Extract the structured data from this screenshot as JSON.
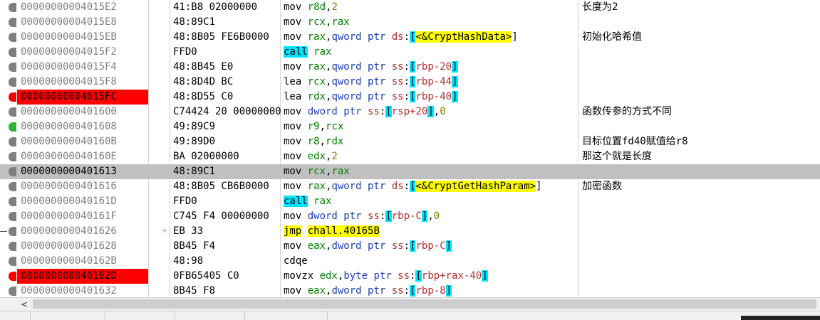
{
  "rows": [
    {
      "address": "00000000004015E2",
      "bytes": "41:B8 02000000",
      "comment": "长度为2"
    },
    {
      "address": "00000000004015E8",
      "bytes": "48:89C1",
      "comment": ""
    },
    {
      "address": "00000000004015EB",
      "bytes": "48:8B05 FE6B0000",
      "comment": "初始化哈希值"
    },
    {
      "address": "00000000004015F2",
      "bytes": "FFD0",
      "comment": ""
    },
    {
      "address": "00000000004015F4",
      "bytes": "48:8B45 E0",
      "comment": ""
    },
    {
      "address": "00000000004015F8",
      "bytes": "48:8D4D BC",
      "comment": ""
    },
    {
      "address": "00000000004015FC",
      "bytes": "48:8D55 C0",
      "comment": ""
    },
    {
      "address": "0000000000401600",
      "bytes": "C74424 20 00000000",
      "comment": "函数传参的方式不同"
    },
    {
      "address": "0000000000401608",
      "bytes": "49:89C9",
      "comment": ""
    },
    {
      "address": "000000000040160B",
      "bytes": "49:89D0",
      "comment": "目标位置fd40赋值给r8"
    },
    {
      "address": "000000000040160E",
      "bytes": "BA 02000000",
      "comment": "那这个就是长度"
    },
    {
      "address": "0000000000401613",
      "bytes": "48:89C1",
      "comment": ""
    },
    {
      "address": "0000000000401616",
      "bytes": "48:8B05 CB6B0000",
      "comment": "加密函数"
    },
    {
      "address": "000000000040161D",
      "bytes": "FFD0",
      "comment": ""
    },
    {
      "address": "000000000040161F",
      "bytes": "C745 F4 00000000",
      "comment": ""
    },
    {
      "address": "0000000000401626",
      "bytes": "EB 33",
      "comment": ""
    },
    {
      "address": "0000000000401628",
      "bytes": "8B45 F4",
      "comment": ""
    },
    {
      "address": "000000000040162B",
      "bytes": "48:98",
      "comment": ""
    },
    {
      "address": "000000000040162D",
      "bytes": "0FB65405 C0",
      "comment": ""
    },
    {
      "address": "0000000000401632",
      "bytes": "8B45 F8",
      "comment": ""
    }
  ],
  "asm": [
    [
      {
        "t": "mov ",
        "c": ""
      },
      {
        "t": "r8d",
        "c": "reg"
      },
      {
        "t": ",",
        "c": ""
      },
      {
        "t": "2",
        "c": "num"
      }
    ],
    [
      {
        "t": "mov ",
        "c": ""
      },
      {
        "t": "rcx",
        "c": "reg"
      },
      {
        "t": ",",
        "c": ""
      },
      {
        "t": "rax",
        "c": "reg"
      }
    ],
    [
      {
        "t": "mov ",
        "c": ""
      },
      {
        "t": "rax",
        "c": "reg"
      },
      {
        "t": ",",
        "c": ""
      },
      {
        "t": "qword ptr ",
        "c": "ptrkw"
      },
      {
        "t": "ds",
        "c": "seg"
      },
      {
        "t": ":",
        "c": ""
      },
      {
        "t": "[",
        "c": "br"
      },
      {
        "t": "<&CryptHashData>",
        "c": "sym"
      },
      {
        "t": "]",
        "c": ""
      }
    ],
    [
      {
        "t": "call",
        "c": "kw-call"
      },
      {
        "t": " ",
        "c": ""
      },
      {
        "t": "rax",
        "c": "reg"
      }
    ],
    [
      {
        "t": "mov ",
        "c": ""
      },
      {
        "t": "rax",
        "c": "reg"
      },
      {
        "t": ",",
        "c": ""
      },
      {
        "t": "qword ptr ",
        "c": "ptrkw"
      },
      {
        "t": "ss",
        "c": "seg"
      },
      {
        "t": ":",
        "c": ""
      },
      {
        "t": "[",
        "c": "br"
      },
      {
        "t": "rbp-20",
        "c": "off"
      },
      {
        "t": "]",
        "c": "br"
      }
    ],
    [
      {
        "t": "lea ",
        "c": ""
      },
      {
        "t": "rcx",
        "c": "reg"
      },
      {
        "t": ",",
        "c": ""
      },
      {
        "t": "qword ptr ",
        "c": "ptrkw"
      },
      {
        "t": "ss",
        "c": "seg"
      },
      {
        "t": ":",
        "c": ""
      },
      {
        "t": "[",
        "c": "br"
      },
      {
        "t": "rbp-44",
        "c": "off"
      },
      {
        "t": "]",
        "c": "br"
      }
    ],
    [
      {
        "t": "lea ",
        "c": ""
      },
      {
        "t": "rdx",
        "c": "reg"
      },
      {
        "t": ",",
        "c": ""
      },
      {
        "t": "qword ptr ",
        "c": "ptrkw"
      },
      {
        "t": "ss",
        "c": "seg"
      },
      {
        "t": ":",
        "c": ""
      },
      {
        "t": "[",
        "c": "br"
      },
      {
        "t": "rbp-40",
        "c": "off"
      },
      {
        "t": "]",
        "c": "br"
      }
    ],
    [
      {
        "t": "mov ",
        "c": ""
      },
      {
        "t": "dword ptr ",
        "c": "ptrkw"
      },
      {
        "t": "ss",
        "c": "seg"
      },
      {
        "t": ":",
        "c": ""
      },
      {
        "t": "[",
        "c": "br"
      },
      {
        "t": "rsp+20",
        "c": "off"
      },
      {
        "t": "]",
        "c": "br"
      },
      {
        "t": ",",
        "c": ""
      },
      {
        "t": "0",
        "c": "num"
      }
    ],
    [
      {
        "t": "mov ",
        "c": ""
      },
      {
        "t": "r9",
        "c": "reg"
      },
      {
        "t": ",",
        "c": ""
      },
      {
        "t": "rcx",
        "c": "reg"
      }
    ],
    [
      {
        "t": "mov ",
        "c": ""
      },
      {
        "t": "r8",
        "c": "reg"
      },
      {
        "t": ",",
        "c": ""
      },
      {
        "t": "rdx",
        "c": "reg"
      }
    ],
    [
      {
        "t": "mov ",
        "c": ""
      },
      {
        "t": "edx",
        "c": "reg"
      },
      {
        "t": ",",
        "c": ""
      },
      {
        "t": "2",
        "c": "num"
      }
    ],
    [
      {
        "t": "mov ",
        "c": ""
      },
      {
        "t": "rcx",
        "c": "reg"
      },
      {
        "t": ",",
        "c": ""
      },
      {
        "t": "rax",
        "c": "reg"
      }
    ],
    [
      {
        "t": "mov ",
        "c": ""
      },
      {
        "t": "rax",
        "c": "reg"
      },
      {
        "t": ",",
        "c": ""
      },
      {
        "t": "qword ptr ",
        "c": "ptrkw"
      },
      {
        "t": "ds",
        "c": "seg"
      },
      {
        "t": ":",
        "c": ""
      },
      {
        "t": "[",
        "c": "br"
      },
      {
        "t": "<&CryptGetHashParam>",
        "c": "sym"
      },
      {
        "t": "]",
        "c": ""
      }
    ],
    [
      {
        "t": "call",
        "c": "kw-call"
      },
      {
        "t": " ",
        "c": ""
      },
      {
        "t": "rax",
        "c": "reg"
      }
    ],
    [
      {
        "t": "mov ",
        "c": ""
      },
      {
        "t": "dword ptr ",
        "c": "ptrkw"
      },
      {
        "t": "ss",
        "c": "seg"
      },
      {
        "t": ":",
        "c": ""
      },
      {
        "t": "[",
        "c": "br"
      },
      {
        "t": "rbp-C",
        "c": "off"
      },
      {
        "t": "]",
        "c": "br"
      },
      {
        "t": ",",
        "c": ""
      },
      {
        "t": "0",
        "c": "num"
      }
    ],
    [
      {
        "t": "jmp",
        "c": "kw-jmp"
      },
      {
        "t": " ",
        "c": ""
      },
      {
        "t": "chall.40165B",
        "c": "sym"
      }
    ],
    [
      {
        "t": "mov ",
        "c": ""
      },
      {
        "t": "eax",
        "c": "reg"
      },
      {
        "t": ",",
        "c": ""
      },
      {
        "t": "dword ptr ",
        "c": "ptrkw"
      },
      {
        "t": "ss",
        "c": "seg"
      },
      {
        "t": ":",
        "c": ""
      },
      {
        "t": "[",
        "c": "br"
      },
      {
        "t": "rbp-C",
        "c": "off"
      },
      {
        "t": "]",
        "c": "br"
      }
    ],
    [
      {
        "t": "cdqe",
        "c": ""
      }
    ],
    [
      {
        "t": "movzx ",
        "c": ""
      },
      {
        "t": "edx",
        "c": "reg"
      },
      {
        "t": ",",
        "c": ""
      },
      {
        "t": "byte ptr ",
        "c": "ptrkw"
      },
      {
        "t": "ss",
        "c": "seg"
      },
      {
        "t": ":",
        "c": ""
      },
      {
        "t": "[",
        "c": "br"
      },
      {
        "t": "rbp+rax-40",
        "c": "off"
      },
      {
        "t": "]",
        "c": "br"
      }
    ],
    [
      {
        "t": "mov ",
        "c": ""
      },
      {
        "t": "eax",
        "c": "reg"
      },
      {
        "t": ",",
        "c": ""
      },
      {
        "t": "dword ptr ",
        "c": "ptrkw"
      },
      {
        "t": "ss",
        "c": "seg"
      },
      {
        "t": ":",
        "c": ""
      },
      {
        "t": "[",
        "c": "br"
      },
      {
        "t": "rbp-8",
        "c": "off"
      },
      {
        "t": "]",
        "c": "br"
      }
    ]
  ],
  "breakpoints": {
    "6": "red",
    "18": "red",
    "8": "green"
  },
  "selected_row": 11,
  "jump_row": 15,
  "jump_arrow_glyph": "˅",
  "scrollbar": {
    "left_arrow": "<"
  },
  "colors": {
    "breakpoint": "#ff0000",
    "selection": "#c0c0c0",
    "call_highlight": "#00e5ff",
    "jmp_highlight": "#ffff00"
  }
}
